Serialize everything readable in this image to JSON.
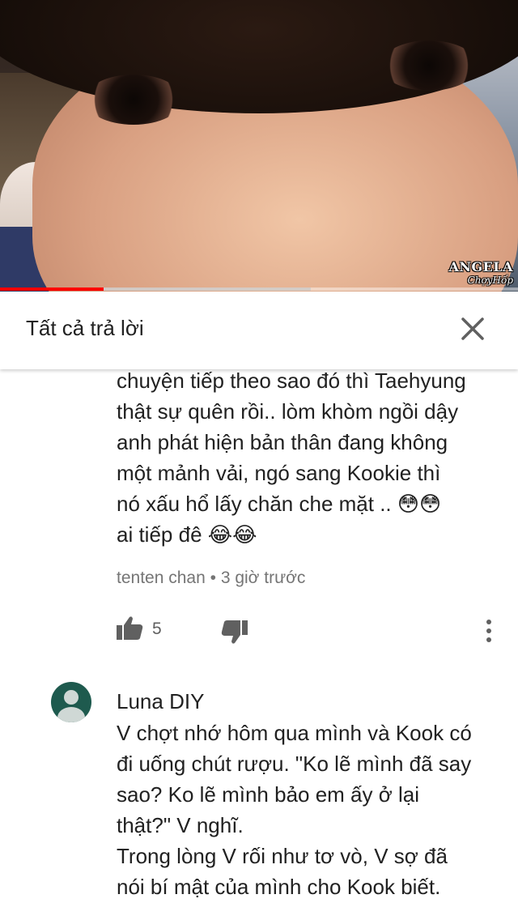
{
  "video": {
    "watermark_line1": "ANGELA",
    "watermark_line2": "ChợyHốp",
    "progress_played_fraction": 0.2,
    "progress_buffered_fraction": 0.6
  },
  "panel": {
    "title": "Tất cả trả lời",
    "close_icon": "close-icon"
  },
  "comments": [
    {
      "text": "chuyện tiếp theo sao đó thì Taehyung\nthật sự quên rồi.. lòm khòm ngồi dậy\nanh phát hiện bản thân đang không\nmột mảnh vải, ngó sang Kookie thì\nnó xấu hổ lấy chăn che mặt .. 😳😳\nai tiếp đê 😂😂",
      "author": "tenten chan",
      "separator": "•",
      "time": "3 giờ trước",
      "likes": "5"
    },
    {
      "author": "Luna DIY",
      "text": "V chợt nhớ hôm qua mình và Kook có\nđi uống chút rượu. \"Ko lẽ mình đã say\nsao? Ko lẽ mình bảo em ấy ở lại\nthật?\" V nghĩ.\nTrong lòng V rối như tơ vò, V sợ đã\nnói bí mật của mình cho Kook biết."
    }
  ],
  "colors": {
    "progress_played": "#ff0000",
    "avatar_bg": "#1e5a4e",
    "meta_text": "#757575"
  }
}
